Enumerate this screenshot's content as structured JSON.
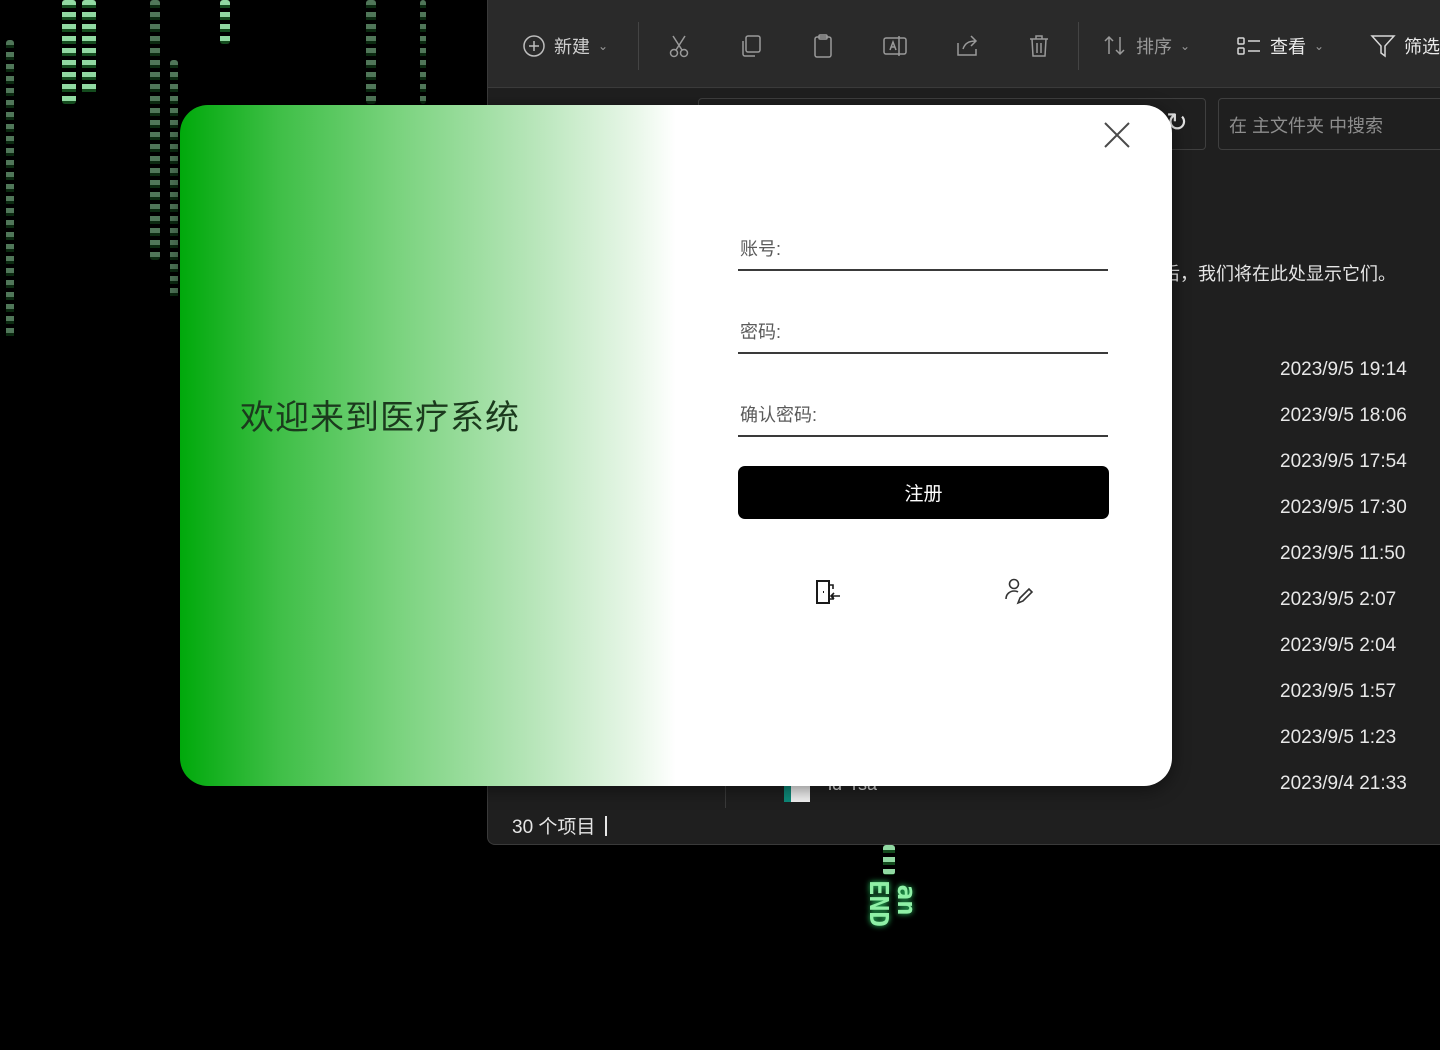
{
  "explorer": {
    "toolbar": {
      "new_label": "新建",
      "sort_label": "排序",
      "view_label": "查看",
      "filter_label": "筛选"
    },
    "search_placeholder": "在 主文件夹 中搜索",
    "empty_hint": "后，我们将在此处显示它们。",
    "file_dates": [
      "2023/9/5 19:14",
      "2023/9/5 18:06",
      "2023/9/5 17:54",
      "2023/9/5 17:30",
      "2023/9/5 11:50",
      "2023/9/5 2:07",
      "2023/9/5 2:04",
      "2023/9/5 1:57",
      "2023/9/5 1:23",
      "2023/9/4 21:33"
    ],
    "partial_file_name": "id_rsa",
    "status_count": "30 个项目"
  },
  "wallpaper": {
    "vertical_text": "an END"
  },
  "dialog": {
    "welcome_text": "欢迎来到医疗系统",
    "account_label": "账号:",
    "password_label": "密码:",
    "confirm_label": "确认密码:",
    "account_value": "",
    "password_value": "",
    "confirm_value": "",
    "submit_label": "注册"
  },
  "colors": {
    "gradient_start": "#00a90b",
    "submit_bg": "#000000",
    "explorer_bg": "#1f1f1f"
  },
  "icons": {
    "close": "close-icon",
    "exit": "exit-door-icon",
    "edit_user": "edit-user-icon"
  }
}
